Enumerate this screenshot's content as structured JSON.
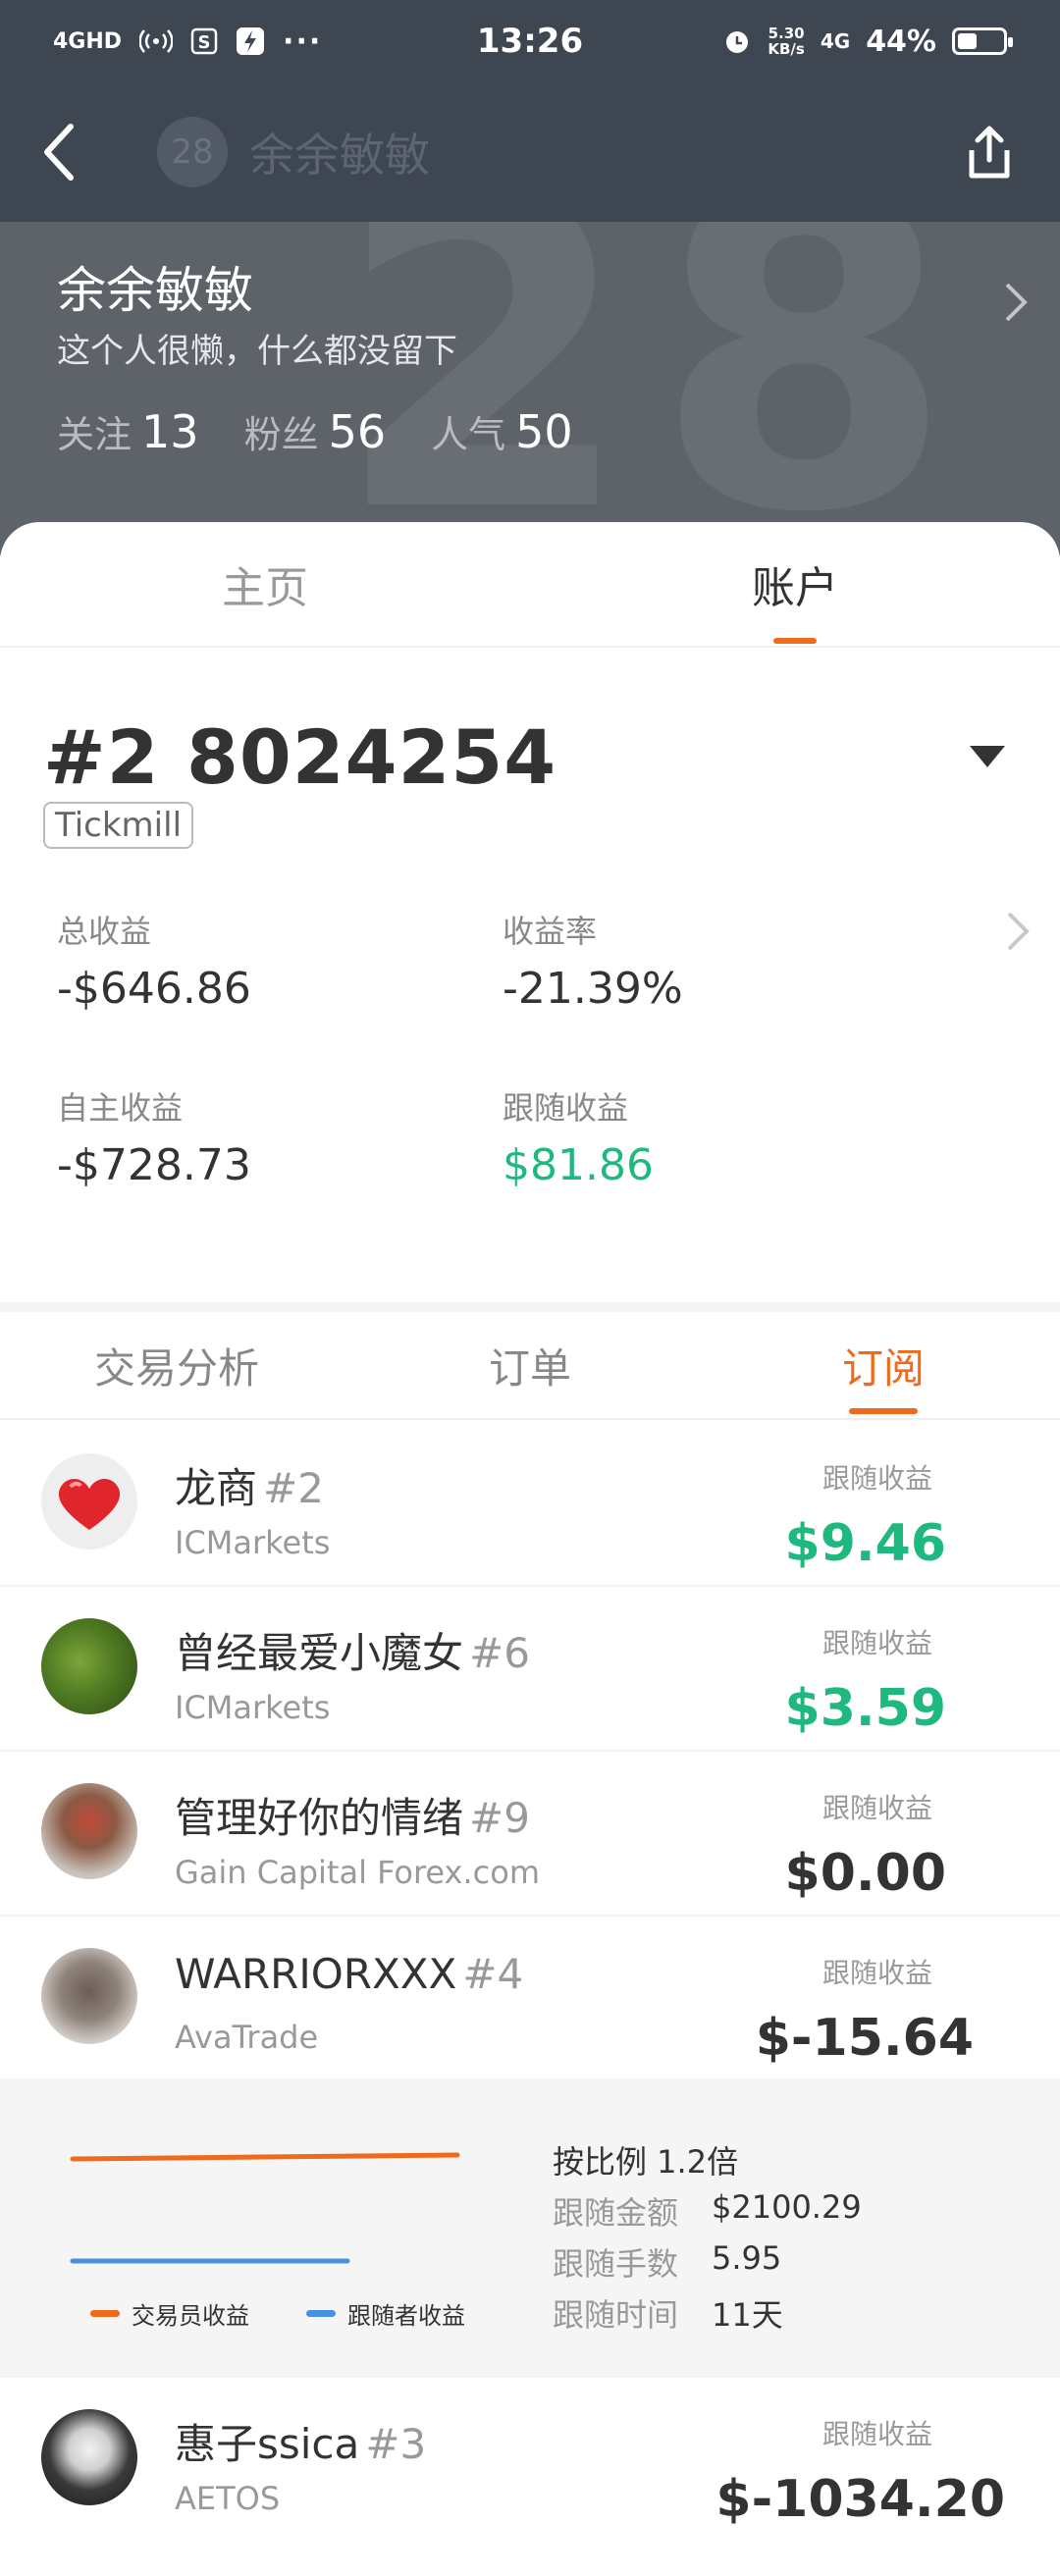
{
  "status_bar": {
    "network": "4GHD",
    "time": "13:26",
    "speed_value": "5.30",
    "speed_unit": "KB/s",
    "net_type": "4G",
    "battery": "44%",
    "battery_level": 0.44
  },
  "header": {
    "avatar_text": "28",
    "title": "余余敏敏"
  },
  "profile": {
    "watermark": "28",
    "name": "余余敏敏",
    "bio": "这个人很懒，什么都没留下",
    "follow_label": "关注",
    "follow_count": "13",
    "fans_label": "粉丝",
    "fans_count": "56",
    "popularity_label": "人气",
    "popularity_count": "50"
  },
  "main_tabs": [
    {
      "label": "主页",
      "active": false
    },
    {
      "label": "账户",
      "active": true
    }
  ],
  "account": {
    "number": "#2 8024254",
    "broker": "Tickmill",
    "metrics": {
      "total_label": "总收益",
      "total_value": "-$646.86",
      "rate_label": "收益率",
      "rate_value": "-21.39%",
      "self_label": "自主收益",
      "self_value": "-$728.73",
      "follow_label": "跟随收益",
      "follow_value": "$81.86"
    }
  },
  "sub_tabs": [
    {
      "label": "交易分析",
      "active": false
    },
    {
      "label": "订单",
      "active": false
    },
    {
      "label": "订阅",
      "active": true
    }
  ],
  "subscriptions": [
    {
      "name": "龙商",
      "num": "#2",
      "broker": "ICMarkets",
      "label": "跟随收益",
      "value": "$9.46"
    },
    {
      "name": "曾经最爱小魔女",
      "num": "#6",
      "broker": "ICMarkets",
      "label": "跟随收益",
      "value": "$3.59"
    },
    {
      "name": "管理好你的情绪",
      "num": "#9",
      "broker": "Gain Capital Forex.com",
      "label": "跟随收益",
      "value": "$0.00"
    },
    {
      "name": "WARRIORXXX",
      "num": "#4",
      "broker": "AvaTrade",
      "label": "跟随收益",
      "value": "$-15.64"
    },
    {
      "name": "惠子ssica",
      "num": "#3",
      "broker": "AETOS",
      "label": "跟随收益",
      "value": "$-1034.20"
    }
  ],
  "detail": {
    "ratio": "按比例 1.2倍",
    "amount_label": "跟随金额",
    "amount_value": "$2100.29",
    "lots_label": "跟随手数",
    "lots_value": "5.95",
    "time_label": "跟随时间",
    "time_value": "11天",
    "legend_trader": "交易员收益",
    "legend_follower": "跟随者收益"
  },
  "colors": {
    "header_bg": "#3e4652",
    "accent": "#f06a1c",
    "positive": "#1fb87f",
    "trader_line": "#f06a1c",
    "follower_line": "#4a90e2"
  }
}
